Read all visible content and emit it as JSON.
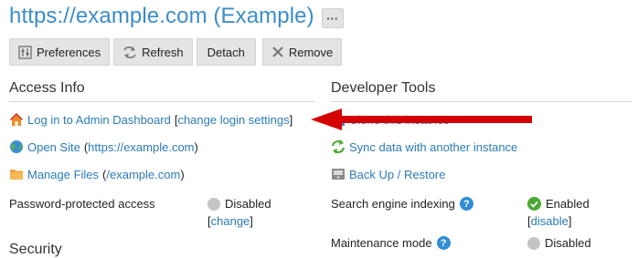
{
  "header": {
    "title": "https://example.com (Example)",
    "more_label": "···"
  },
  "toolbar": {
    "preferences": "Preferences",
    "refresh": "Refresh",
    "detach": "Detach",
    "remove": "Remove"
  },
  "access_info": {
    "title": "Access Info",
    "login_link": "Log in to Admin Dashboard",
    "bracket_open": "[",
    "change_login": "change login settings",
    "bracket_close": "]",
    "open_site": "Open Site",
    "open_site_paren_open": "(",
    "open_site_url": "https://example.com",
    "open_site_paren_close": ")",
    "manage_files": "Manage Files",
    "manage_files_paren_open": "(",
    "manage_files_path": "/example.com",
    "manage_files_paren_close": ")",
    "password_label": "Password-protected access",
    "password_status": "Disabled",
    "password_change_open": "[",
    "password_change": "change",
    "password_change_close": "]"
  },
  "security": {
    "title": "Security"
  },
  "developer_tools": {
    "title": "Developer Tools",
    "hidden_item": "Clone this instance",
    "sync": "Sync data with another instance",
    "backup": "Back Up / Restore",
    "indexing_label": "Search engine indexing",
    "help_glyph": "?",
    "indexing_status": "Enabled",
    "indexing_action": "disable",
    "maintenance_label": "Maintenance mode",
    "maintenance_status": "Disabled"
  },
  "colors": {
    "link": "#2b7bb9",
    "title": "#3c8dc8",
    "arrow": "#d40000",
    "enabled": "#4aa832",
    "disabled": "#c4c4c4",
    "help": "#2f8ed6"
  }
}
